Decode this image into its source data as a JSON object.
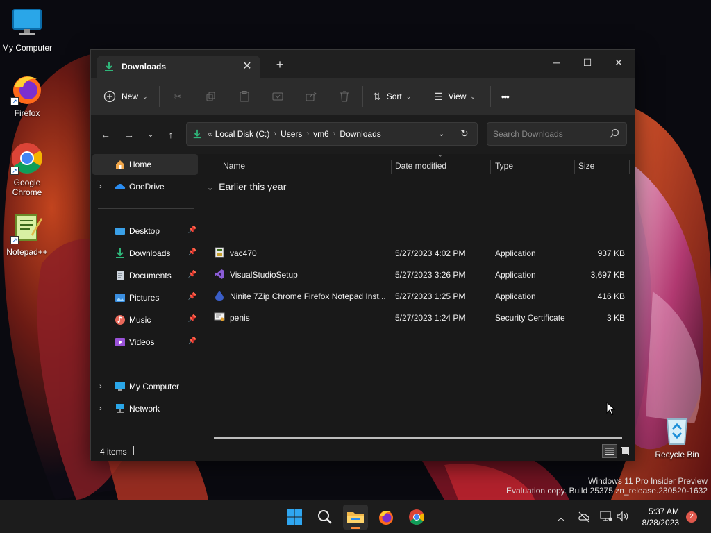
{
  "desktop": {
    "icons": [
      {
        "label": "My Computer",
        "icon": "monitor-icon"
      },
      {
        "label": "Firefox",
        "icon": "firefox-icon"
      },
      {
        "label": "Google Chrome",
        "icon": "chrome-icon"
      },
      {
        "label": "Notepad++",
        "icon": "notepadpp-icon"
      },
      {
        "label": "Recycle Bin",
        "icon": "recycle-bin-icon"
      }
    ],
    "watermark": {
      "line1": "Windows 11 Pro Insider Preview",
      "line2": "Evaluation copy. Build 25375.zn_release.230520-1632"
    }
  },
  "window": {
    "tab": {
      "title": "Downloads",
      "icon": "download-icon"
    },
    "controls": {
      "minimize": "─",
      "maximize": "☐",
      "close": "✕"
    },
    "toolbar": {
      "new_label": "New",
      "sort_label": "Sort",
      "view_label": "View",
      "more_label": "•••"
    },
    "address": {
      "overflow": "«",
      "crumbs": [
        "Local Disk (C:)",
        "Users",
        "vm6",
        "Downloads"
      ]
    },
    "search": {
      "placeholder": "Search Downloads"
    },
    "navpane": {
      "items": [
        {
          "label": "Home",
          "icon": "home-icon"
        },
        {
          "label": "OneDrive",
          "icon": "cloud-icon"
        },
        {
          "label": "Desktop",
          "icon": "desktop-folder-icon"
        },
        {
          "label": "Downloads",
          "icon": "download-folder-icon"
        },
        {
          "label": "Documents",
          "icon": "documents-folder-icon"
        },
        {
          "label": "Pictures",
          "icon": "pictures-folder-icon"
        },
        {
          "label": "Music",
          "icon": "music-folder-icon"
        },
        {
          "label": "Videos",
          "icon": "videos-folder-icon"
        },
        {
          "label": "My Computer",
          "icon": "computer-icon"
        },
        {
          "label": "Network",
          "icon": "network-icon"
        }
      ]
    },
    "columns": [
      "Name",
      "Date modified",
      "Type",
      "Size"
    ],
    "group": "Earlier this year",
    "files": [
      {
        "name": "vac470",
        "date": "5/27/2023 4:02 PM",
        "type": "Application",
        "size": "937 KB",
        "icon": "installer-icon"
      },
      {
        "name": "VisualStudioSetup",
        "date": "5/27/2023 3:26 PM",
        "type": "Application",
        "size": "3,697 KB",
        "icon": "visual-studio-icon"
      },
      {
        "name": "Ninite 7Zip Chrome Firefox Notepad Inst...",
        "date": "5/27/2023 1:25 PM",
        "type": "Application",
        "size": "416 KB",
        "icon": "ninite-icon"
      },
      {
        "name": "penis",
        "date": "5/27/2023 1:24 PM",
        "type": "Security Certificate",
        "size": "3 KB",
        "icon": "certificate-icon"
      }
    ],
    "status": {
      "count": "4 items"
    }
  },
  "taskbar": {
    "clock_time": "5:37 AM",
    "clock_date": "8/28/2023",
    "notifications": "2"
  }
}
